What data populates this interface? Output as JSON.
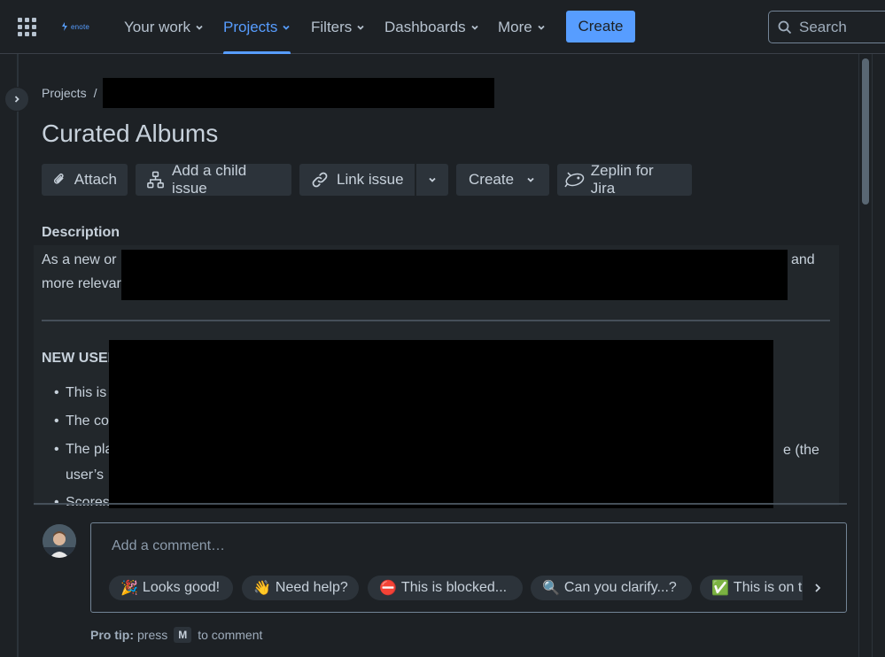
{
  "nav": {
    "logo_text": "enote",
    "items": [
      {
        "label": "Your work"
      },
      {
        "label": "Projects"
      },
      {
        "label": "Filters"
      },
      {
        "label": "Dashboards"
      },
      {
        "label": "More"
      }
    ],
    "create_label": "Create",
    "search_placeholder": "Search"
  },
  "breadcrumb": {
    "root": "Projects",
    "separator": "/"
  },
  "issue": {
    "title": "Curated Albums",
    "toolbar": {
      "attach": "Attach",
      "add_child": "Add a child issue",
      "link_issue": "Link issue",
      "create": "Create",
      "zeplin": "Zeplin for Jira"
    },
    "description_label": "Description",
    "description": {
      "line1_start": "As a new or",
      "line1_end": "and",
      "line2_start": "more relevar",
      "heading": "NEW USEI",
      "bullets": [
        {
          "start": "This is",
          "end": ""
        },
        {
          "start": "The co",
          "end": ""
        },
        {
          "start": "The pla",
          "end": "e (the"
        },
        {
          "start": "user’s",
          "end": ""
        },
        {
          "start": "Scores",
          "end": ""
        }
      ]
    }
  },
  "comment": {
    "placeholder": "Add a comment…",
    "chips": [
      {
        "emoji": "🎉",
        "label": "Looks good!"
      },
      {
        "emoji": "👋",
        "label": "Need help?"
      },
      {
        "emoji": "⛔",
        "label": "This is blocked..."
      },
      {
        "emoji": "🔍",
        "label": "Can you clarify...?"
      },
      {
        "emoji": "✅",
        "label": "This is on t"
      }
    ],
    "pro_tip_label": "Pro tip:",
    "pro_tip_press": "press",
    "pro_tip_key": "M",
    "pro_tip_end": "to comment"
  },
  "colors": {
    "accent": "#579dff",
    "background": "#1d2125",
    "surface": "#2c333a"
  }
}
